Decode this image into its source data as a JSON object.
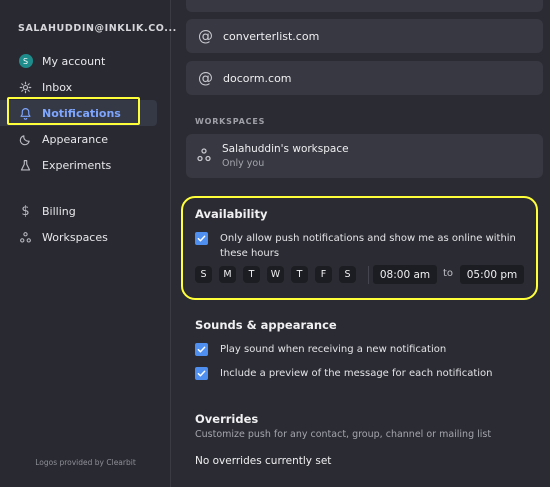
{
  "sidebar": {
    "account_email": "SALAHUDDIN@INKLIK.CO...",
    "avatar_letter": "S",
    "items": [
      {
        "label": "My account"
      },
      {
        "label": "Inbox"
      },
      {
        "label": "Notifications"
      },
      {
        "label": "Appearance"
      },
      {
        "label": "Experiments"
      },
      {
        "label": "Billing"
      },
      {
        "label": "Workspaces"
      }
    ],
    "footer": "Logos provided by Clearbit"
  },
  "domains": [
    {
      "name": "converterlist.com"
    },
    {
      "name": "docorm.com"
    }
  ],
  "workspaces": {
    "section_label": "WORKSPACES",
    "items": [
      {
        "name": "Salahuddin's workspace",
        "sub": "Only you"
      }
    ]
  },
  "availability": {
    "title": "Availability",
    "checkbox_line1": "Only allow push notifications and show me as online within",
    "checkbox_line2": "these hours",
    "checked": true,
    "days": [
      "S",
      "M",
      "T",
      "W",
      "T",
      "F",
      "S"
    ],
    "start_time": "08:00 am",
    "to_label": "to",
    "end_time": "05:00 pm"
  },
  "sounds": {
    "title": "Sounds & appearance",
    "options": [
      {
        "label": "Play sound when receiving a new notification",
        "checked": true
      },
      {
        "label": "Include a preview of the message for each notification",
        "checked": true
      }
    ]
  },
  "overrides": {
    "title": "Overrides",
    "subtitle": "Customize push for any contact, group, channel or mailing list",
    "empty_text": "No overrides currently set"
  },
  "colors": {
    "accent": "#7ea6ff",
    "checkbox": "#4f8ff0",
    "highlight": "#ffff3a"
  }
}
